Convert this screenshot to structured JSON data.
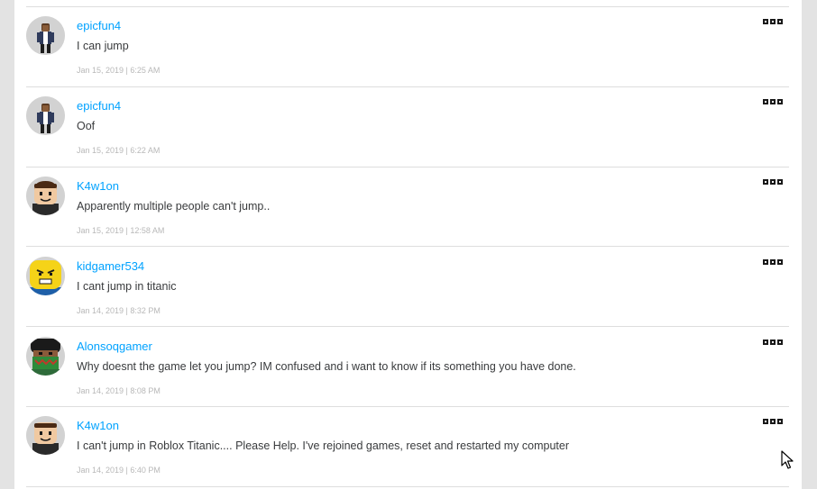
{
  "comments": [
    {
      "username": "epicfun4",
      "text": "I can jump",
      "timestamp": "Jan 15, 2019 | 6:25 AM",
      "avatar": "avatar-epicfun4"
    },
    {
      "username": "epicfun4",
      "text": "Oof",
      "timestamp": "Jan 15, 2019 | 6:22 AM",
      "avatar": "avatar-epicfun4"
    },
    {
      "username": "K4w1on",
      "text": "Apparently multiple people can't jump..",
      "timestamp": "Jan 15, 2019 | 12:58 AM",
      "avatar": "avatar-k4w1on"
    },
    {
      "username": "kidgamer534",
      "text": "I cant jump in titanic",
      "timestamp": "Jan 14, 2019 | 8:32 PM",
      "avatar": "avatar-kidgamer534"
    },
    {
      "username": "Alonsoqgamer",
      "text": "Why doesnt the game let you jump? IM confused and i want to know if its something you have done.",
      "timestamp": "Jan 14, 2019 | 8:08 PM",
      "avatar": "avatar-alonsoqgamer"
    },
    {
      "username": "K4w1on",
      "text": "I can't jump in Roblox Titanic.... Please Help. I've rejoined games, reset and restarted my computer",
      "timestamp": "Jan 14, 2019 | 6:40 PM",
      "avatar": "avatar-k4w1on"
    }
  ],
  "icons": {
    "more": "more-options-icon",
    "cursor": "mouse-pointer-icon"
  },
  "colors": {
    "username": "#00a2ff",
    "text": "#393b3d",
    "timestamp": "#b8b8b8",
    "divider": "#dedede",
    "page_background": "#e3e3e3"
  }
}
